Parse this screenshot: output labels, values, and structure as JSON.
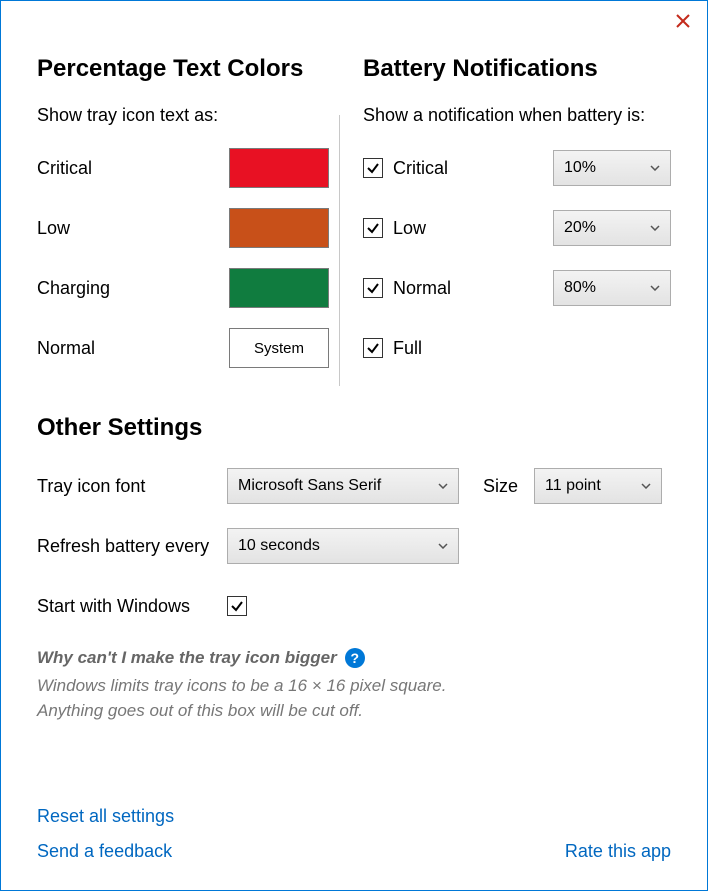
{
  "colors_section": {
    "title": "Percentage Text Colors",
    "subtitle": "Show tray icon text as:",
    "items": [
      {
        "label": "Critical",
        "color": "#e81123",
        "type": "color"
      },
      {
        "label": "Low",
        "color": "#c85019",
        "type": "color"
      },
      {
        "label": "Charging",
        "color": "#107c3f",
        "type": "color"
      },
      {
        "label": "Normal",
        "text": "System",
        "type": "system"
      }
    ]
  },
  "notif_section": {
    "title": "Battery Notifications",
    "subtitle": "Show a notification when battery is:",
    "items": [
      {
        "label": "Critical",
        "checked": true,
        "value": "10%"
      },
      {
        "label": "Low",
        "checked": true,
        "value": "20%"
      },
      {
        "label": "Normal",
        "checked": true,
        "value": "80%"
      },
      {
        "label": "Full",
        "checked": true,
        "value": null
      }
    ]
  },
  "other_section": {
    "title": "Other Settings",
    "font_label": "Tray icon font",
    "font_value": "Microsoft Sans Serif",
    "size_label": "Size",
    "size_value": "11 point",
    "refresh_label": "Refresh battery every",
    "refresh_value": "10 seconds",
    "startup_label": "Start with Windows",
    "startup_checked": true
  },
  "help": {
    "title": "Why can't I make the tray icon bigger",
    "body_line1": "Windows limits tray icons to be a 16 × 16 pixel square.",
    "body_line2": "Anything goes out of this box will be cut off."
  },
  "links": {
    "reset": "Reset all settings",
    "feedback": "Send a feedback",
    "rate": "Rate this app"
  }
}
